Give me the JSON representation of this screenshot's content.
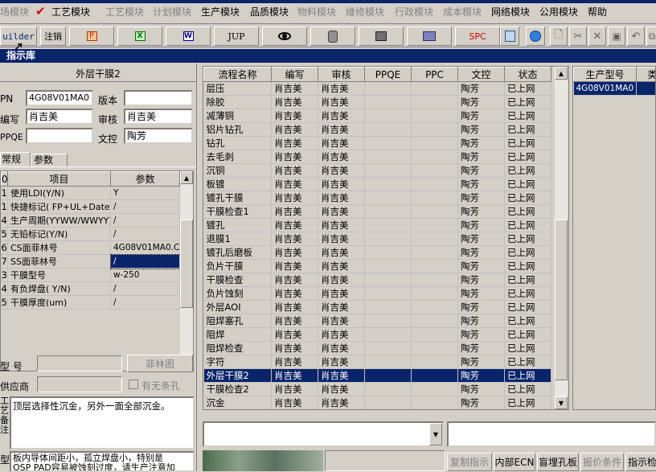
{
  "menu": [
    "场模块",
    "工艺模块",
    "工艺模块",
    "计划模块",
    "生产模块",
    "品质模块",
    "物料模块",
    "维修模块",
    "行政模块",
    "成本模块",
    "网络模块",
    "公用模块",
    "帮助"
  ],
  "toolbar": {
    "builder": "uilder",
    "logout": "注销",
    "jup": "JUP",
    "spc": "SPC"
  },
  "window_title": "指示库",
  "left": {
    "header": "外层干膜2",
    "pn_label": "PN",
    "pn_value": "4G08V01MA0",
    "version_label": "版本",
    "version_value": "",
    "writer_label": "编写",
    "writer_value": "肖吉美",
    "reviewer_label": "审核",
    "reviewer_value": "肖吉美",
    "ppqe_label": "PPQE",
    "ppqe_value": "",
    "doc_label": "文控",
    "doc_value": "陶芳",
    "tabs": [
      "常规",
      "参数"
    ],
    "param_headers": [
      "0",
      "项目",
      "参数"
    ],
    "params": [
      {
        "no": "1",
        "item": "使用LDI(Y/N)",
        "value": "Y"
      },
      {
        "no": "1",
        "item": "快捷标记( FP+UL+DateC",
        "value": "/"
      },
      {
        "no": "4",
        "item": "生产周期(YYWW/WWYY)",
        "value": "/"
      },
      {
        "no": "5",
        "item": "无铅标记(Y/N)",
        "value": "/"
      },
      {
        "no": "6",
        "item": "CS面菲林号",
        "value": "4G08V01MA0.CS2"
      },
      {
        "no": "7",
        "item": "SS面菲林号",
        "value": "/"
      },
      {
        "no": "3",
        "item": "干膜型号",
        "value": "w-250"
      },
      {
        "no": "4",
        "item": "有负焊盘( Y/N)",
        "value": "/"
      },
      {
        "no": "5",
        "item": "干膜厚度(um)",
        "value": "/"
      }
    ],
    "model_label": "型  号",
    "film_button": "菲林图",
    "supplier_label": "供应商",
    "hole_checkbox": "有无条孔",
    "process_label": "工艺备注",
    "process_note": "顶层选择性沉金，另外一面全部沉金。",
    "bottom_label": "型",
    "bottom_note_1": "板内导体间距小，孤立焊盘小，特别是",
    "bottom_note_2": "OSP PAD容易被蚀刻过度，请生产注意加"
  },
  "center": {
    "headers": [
      "流程名称",
      "编写",
      "审核",
      "PPQE",
      "PPC",
      "文控",
      "状态"
    ],
    "rows": [
      [
        "层压",
        "肖吉美",
        "肖吉美",
        "",
        "",
        "陶芳",
        "已上网"
      ],
      [
        "除胶",
        "肖吉美",
        "肖吉美",
        "",
        "",
        "陶芳",
        "已上网"
      ],
      [
        "减薄铜",
        "肖吉美",
        "肖吉美",
        "",
        "",
        "陶芳",
        "已上网"
      ],
      [
        "铝片钻孔",
        "肖吉美",
        "肖吉美",
        "",
        "",
        "陶芳",
        "已上网"
      ],
      [
        "钻孔",
        "肖吉美",
        "肖吉美",
        "",
        "",
        "陶芳",
        "已上网"
      ],
      [
        "去毛刺",
        "肖吉美",
        "肖吉美",
        "",
        "",
        "陶芳",
        "已上网"
      ],
      [
        "沉铜",
        "肖吉美",
        "肖吉美",
        "",
        "",
        "陶芳",
        "已上网"
      ],
      [
        "板镀",
        "肖吉美",
        "肖吉美",
        "",
        "",
        "陶芳",
        "已上网"
      ],
      [
        "镀孔干膜",
        "肖吉美",
        "肖吉美",
        "",
        "",
        "陶芳",
        "已上网"
      ],
      [
        "干膜检查1",
        "肖吉美",
        "肖吉美",
        "",
        "",
        "陶芳",
        "已上网"
      ],
      [
        "镀孔",
        "肖吉美",
        "肖吉美",
        "",
        "",
        "陶芳",
        "已上网"
      ],
      [
        "退膜1",
        "肖吉美",
        "肖吉美",
        "",
        "",
        "陶芳",
        "已上网"
      ],
      [
        "镀孔后磨板",
        "肖吉美",
        "肖吉美",
        "",
        "",
        "陶芳",
        "已上网"
      ],
      [
        "负片干膜",
        "肖吉美",
        "肖吉美",
        "",
        "",
        "陶芳",
        "已上网"
      ],
      [
        "干膜检查",
        "肖吉美",
        "肖吉美",
        "",
        "",
        "陶芳",
        "已上网"
      ],
      [
        "负片蚀刻",
        "肖吉美",
        "肖吉美",
        "",
        "",
        "陶芳",
        "已上网"
      ],
      [
        "外层AOI",
        "肖吉美",
        "肖吉美",
        "",
        "",
        "陶芳",
        "已上网"
      ],
      [
        "阻焊塞孔",
        "肖吉美",
        "肖吉美",
        "",
        "",
        "陶芳",
        "已上网"
      ],
      [
        "阻焊",
        "肖吉美",
        "肖吉美",
        "",
        "",
        "陶芳",
        "已上网"
      ],
      [
        "阻焊检查",
        "肖吉美",
        "肖吉美",
        "",
        "",
        "陶芳",
        "已上网"
      ],
      [
        "字符",
        "肖吉美",
        "肖吉美",
        "",
        "",
        "陶芳",
        "已上网"
      ],
      [
        "外层干膜2",
        "肖吉美",
        "肖吉美",
        "",
        "",
        "陶芳",
        "已上网"
      ],
      [
        "干膜检查2",
        "肖吉美",
        "肖吉美",
        "",
        "",
        "陶芳",
        "已上网"
      ],
      [
        "沉金",
        "肖吉美",
        "肖吉美",
        "",
        "",
        "陶芳",
        "已上网"
      ]
    ],
    "selected_row": 21
  },
  "right": {
    "headers": [
      "生产型号",
      "类型"
    ],
    "rows": [
      [
        "4G08V01MA0",
        ""
      ]
    ]
  },
  "bottom_buttons": [
    "复制指示",
    "内部ECN",
    "盲埋孔板",
    "报价条件",
    "指示检"
  ]
}
